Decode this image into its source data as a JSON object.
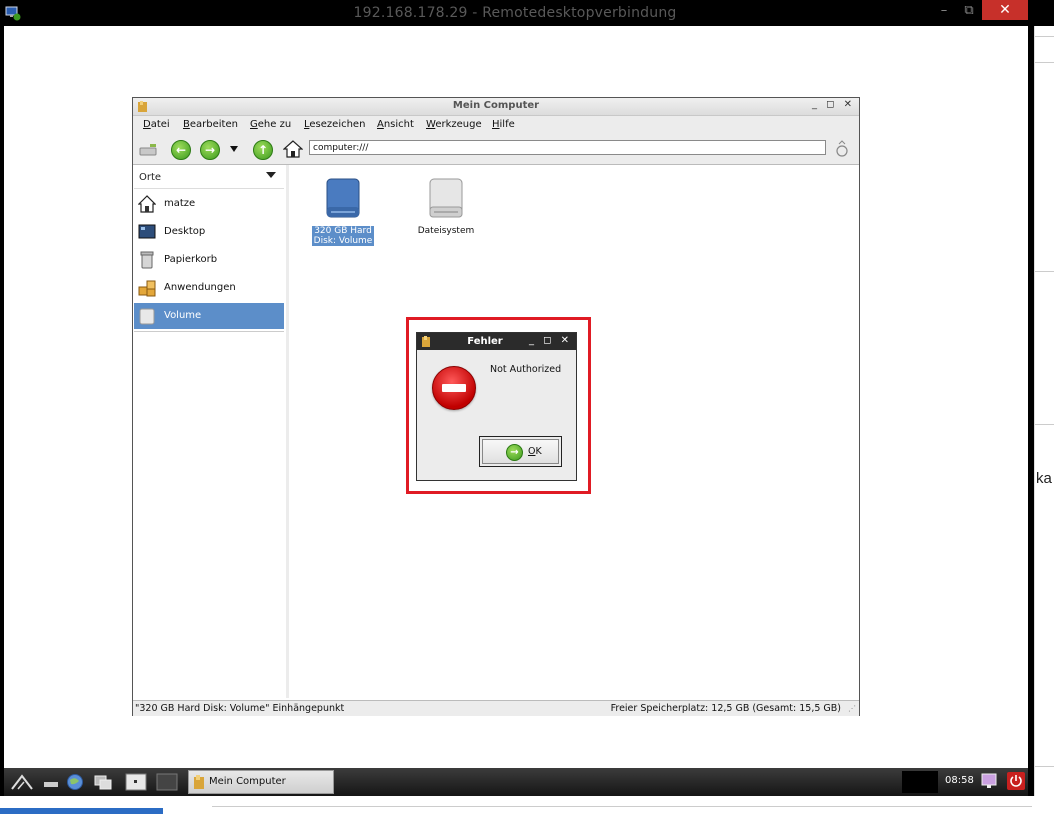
{
  "rdp": {
    "title": "192.168.178.29 - Remotedesktopverbindung",
    "minimize": "–",
    "restore": "⧉",
    "close": "✕"
  },
  "file_manager": {
    "title": "Mein Computer",
    "window_buttons": "_ ◻ ✕",
    "menu": [
      {
        "accel": "D",
        "rest": "atei"
      },
      {
        "accel": "B",
        "rest": "earbeiten"
      },
      {
        "accel": "G",
        "rest": "ehe zu"
      },
      {
        "accel": "L",
        "rest": "esezeichen"
      },
      {
        "accel": "A",
        "rest": "nsicht"
      },
      {
        "accel": "W",
        "rest": "erkzeuge"
      },
      {
        "accel": "H",
        "rest": "ilfe"
      }
    ],
    "address": "computer:///",
    "sidebar": {
      "header": "Orte",
      "items": [
        {
          "label": "matze"
        },
        {
          "label": "Desktop"
        },
        {
          "label": "Papierkorb"
        },
        {
          "label": "Anwendungen"
        },
        {
          "label": "Volume"
        }
      ]
    },
    "files": [
      {
        "line1": "320 GB Hard",
        "line2": "Disk: Volume"
      },
      {
        "line1": "Dateisystem",
        "line2": ""
      }
    ],
    "status_left": "\"320 GB Hard Disk: Volume\" Einhängepunkt",
    "status_right": "Freier Speicherplatz: 12,5 GB (Gesamt: 15,5 GB)"
  },
  "dialog": {
    "title": "Fehler",
    "window_buttons": "_ ◻ ✕",
    "message": "Not Authorized",
    "ok_accel": "O",
    "ok_rest": "K"
  },
  "taskbar": {
    "task_label": "Mein Computer",
    "clock": "08:58"
  },
  "right_partial_text": "ka",
  "colors": {
    "selection": "#5c8ec9",
    "rdp_close": "#c7302a",
    "highlight_border": "#e01b24",
    "dialog_title_bg": "#2b2b2b"
  }
}
